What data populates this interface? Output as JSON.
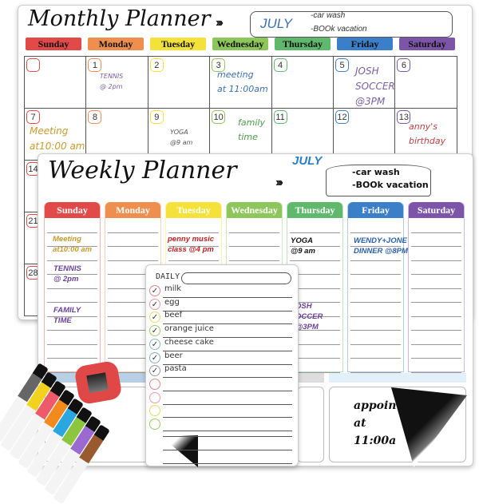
{
  "monthly": {
    "title": "Monthly Planner",
    "chevrons": "›››",
    "month": "JULY",
    "memo": [
      "-car wash",
      "-BOOk vacation"
    ],
    "days": [
      {
        "label": "Sunday",
        "color": "#e24a4a"
      },
      {
        "label": "Monday",
        "color": "#ef8f4f"
      },
      {
        "label": "Tuesday",
        "color": "#f4e23a"
      },
      {
        "label": "Wednesday",
        "color": "#8dc65a"
      },
      {
        "label": "Thursday",
        "color": "#5fb86c"
      },
      {
        "label": "Friday",
        "color": "#3a7fc8"
      },
      {
        "label": "Saturday",
        "color": "#7d55a8"
      }
    ],
    "row1": [
      "",
      "1",
      "2",
      "3",
      "4",
      "5",
      "6"
    ],
    "row2": [
      "7",
      "8",
      "9",
      "10",
      "11",
      "12",
      "13"
    ],
    "left_numbers": [
      "14",
      "21",
      "28"
    ],
    "notes": [
      {
        "text": "TENNIS\n@ 2pm",
        "color": "#7a5fa0"
      },
      {
        "text": "meeting\nat 11:00am",
        "color": "#3a6fb0"
      },
      {
        "text": "JOSH\nSOCCER\n@3PM",
        "color": "#7a5fa0"
      },
      {
        "text": "Meeting\nat10:00 am",
        "color": "#c99a2e"
      },
      {
        "text": "YOGA\n@9 am",
        "color": "#555"
      },
      {
        "text": "family\ntime",
        "color": "#4a9a4a"
      },
      {
        "text": "anny's\nbirthday",
        "color": "#b84040"
      }
    ]
  },
  "weekly": {
    "title": "Weekly Planner",
    "chevrons": "›››",
    "month": "JULY",
    "memo": [
      "-car wash",
      "-BOOk vacation"
    ],
    "days": [
      {
        "label": "Sunday",
        "color": "#e24a4a"
      },
      {
        "label": "Monday",
        "color": "#ef8f4f"
      },
      {
        "label": "Tuesday",
        "color": "#f4e23a"
      },
      {
        "label": "Wednesday",
        "color": "#8dc65a"
      },
      {
        "label": "Thursday",
        "color": "#5fb86c"
      },
      {
        "label": "Friday",
        "color": "#3a7fc8"
      },
      {
        "label": "Saturday",
        "color": "#7d55a8"
      }
    ],
    "notes": [
      {
        "text": "Meeting\nat10:00 am",
        "color": "#c99a2e"
      },
      {
        "text": "TENNIS\n@ 2pm",
        "color": "#6a3f9a"
      },
      {
        "text": "FAMILY\nTIME",
        "color": "#6a3f9a"
      },
      {
        "text": "penny music\nclass @4 pm",
        "color": "#c02020"
      },
      {
        "text": "YOGA\n@9 am",
        "color": "#111"
      },
      {
        "text": "WENDY+JONE\nDINNER @8PM",
        "color": "#2a5ea8"
      },
      {
        "text": "OSH\nOCCER\n@3PM",
        "color": "#6a3f9a"
      }
    ],
    "appointment": "appoin\nat\n11:00a"
  },
  "daily": {
    "title": "DAILY",
    "items": [
      {
        "text": "milk",
        "done": true,
        "color": "#d88"
      },
      {
        "text": "egg",
        "done": true,
        "color": "#e9a"
      },
      {
        "text": "beef",
        "done": true,
        "color": "#dd6"
      },
      {
        "text": "orange juice",
        "done": true,
        "color": "#9c6"
      },
      {
        "text": "cheese cake",
        "done": true,
        "color": "#8bb"
      },
      {
        "text": "beer",
        "done": true,
        "color": "#8ac"
      },
      {
        "text": "pasta",
        "done": true,
        "color": "#999"
      },
      {
        "text": "",
        "done": false,
        "color": "#d88"
      },
      {
        "text": "",
        "done": false,
        "color": "#e9a"
      },
      {
        "text": "",
        "done": false,
        "color": "#dd6"
      },
      {
        "text": "",
        "done": false,
        "color": "#9c6"
      }
    ]
  },
  "markers": [
    "#666",
    "#f2d21e",
    "#ef5a6a",
    "#f28a1e",
    "#2aa6e0",
    "#8cc63e",
    "#9a6ad0",
    "#9a5a30"
  ]
}
